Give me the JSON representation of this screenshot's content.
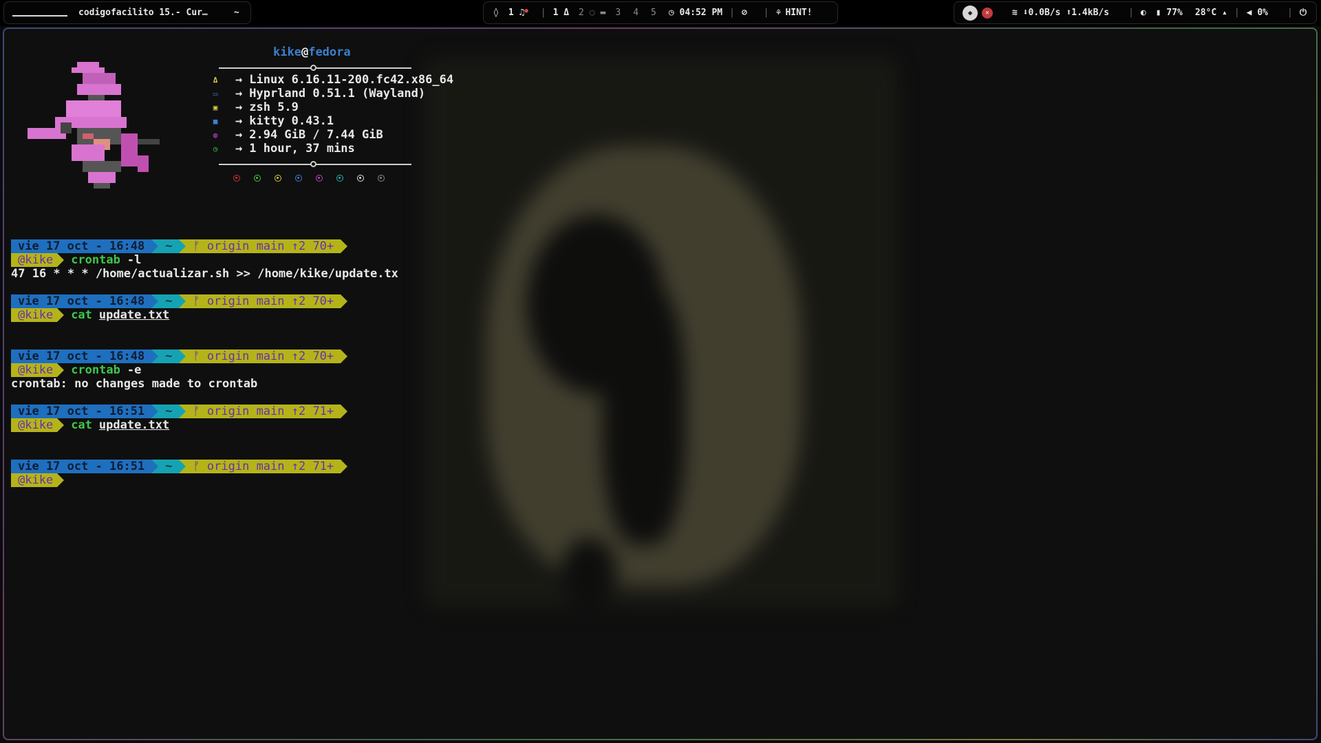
{
  "topbar": {
    "workspace_indicator": "_________",
    "window_title": "codigofacilito  15.- Cur…",
    "left_tilde": "~",
    "notif_count": "1",
    "workspaces": [
      "1",
      "2",
      "3",
      "4",
      "5"
    ],
    "clock": "04:52 PM",
    "hint_label": "HINT!",
    "net_down": "0.0B/s",
    "net_up": "1.4kB/s",
    "battery": "77%",
    "temperature": "28°C",
    "volume": "0%"
  },
  "fastfetch": {
    "user": "kike",
    "at": "@",
    "host": "fedora",
    "rows": [
      {
        "icon": "linux-icon",
        "glyph": "Δ",
        "color": "#d8c640",
        "arrow": "→",
        "text": "Linux 6.16.11-200.fc42.x86_64"
      },
      {
        "icon": "window-manager-icon",
        "glyph": "▭",
        "color": "#3a7fd0",
        "arrow": "→",
        "text": "Hyprland 0.51.1 (Wayland)"
      },
      {
        "icon": "shell-icon",
        "glyph": "▣",
        "color": "#d8c640",
        "arrow": "→",
        "text": "zsh 5.9"
      },
      {
        "icon": "terminal-icon",
        "glyph": "■",
        "color": "#3a7fd0",
        "arrow": "→",
        "text": "kitty 0.43.1"
      },
      {
        "icon": "memory-icon",
        "glyph": "◍",
        "color": "#c040c0",
        "arrow": "→",
        "text": "2.94 GiB / 7.44 GiB"
      },
      {
        "icon": "uptime-icon",
        "glyph": "◷",
        "color": "#3ec84a",
        "arrow": "→",
        "text": "1 hour, 37 mins"
      }
    ],
    "palette": [
      "#d03030",
      "#3ec84a",
      "#d8c640",
      "#3a7fd0",
      "#c040c0",
      "#20b0b8",
      "#dddddd",
      "#8a8a8a"
    ]
  },
  "terminal": {
    "blocks": [
      {
        "date": "vie 17 oct - 16:48",
        "dir": "~",
        "git": "ᚠ origin  main ↑2 70+",
        "user": "@kike",
        "cmd": "crontab",
        "args": "-l",
        "args_underline": false,
        "output": "47 16 * * * /home/actualizar.sh >> /home/kike/update.tx"
      },
      {
        "date": "vie 17 oct - 16:48",
        "dir": "~",
        "git": "ᚠ origin  main ↑2 70+",
        "user": "@kike",
        "cmd": "cat",
        "args": "update.txt",
        "args_underline": true,
        "output": ""
      },
      {
        "date": "vie 17 oct - 16:48",
        "dir": "~",
        "git": "ᚠ origin  main ↑2 70+",
        "user": "@kike",
        "cmd": "crontab",
        "args": "-e",
        "args_underline": false,
        "output": "crontab: no changes made to crontab"
      },
      {
        "date": "vie 17 oct - 16:51",
        "dir": "~",
        "git": "ᚠ origin  main ↑2 71+",
        "user": "@kike",
        "cmd": "cat",
        "args": "update.txt",
        "args_underline": true,
        "output": ""
      },
      {
        "date": "vie 17 oct - 16:51",
        "dir": "~",
        "git": "ᚠ origin  main ↑2 71+",
        "user": "@kike",
        "cmd": "",
        "args": "",
        "args_underline": false,
        "output": ""
      }
    ]
  }
}
